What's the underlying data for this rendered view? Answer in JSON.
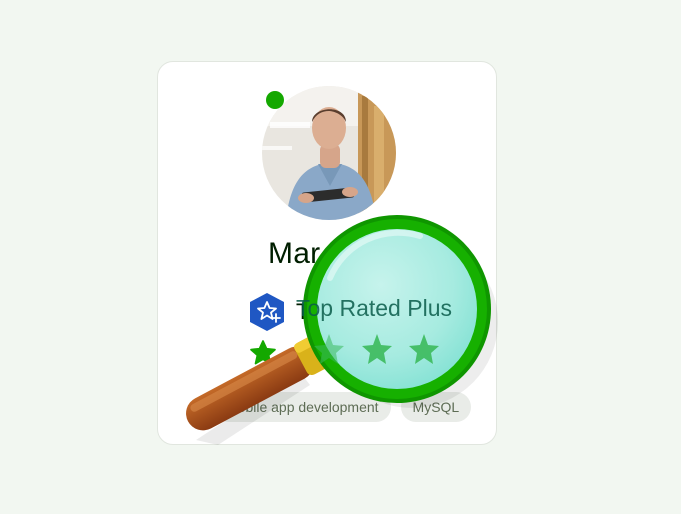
{
  "profile": {
    "name": "Mar",
    "badge_label": "Top Rated Plus",
    "rating": 5,
    "skills": [
      "Mobile app development",
      "MySQL"
    ]
  },
  "colors": {
    "accent": "#14a800",
    "badge_blue": "#1f57c3",
    "text": "#001e00"
  },
  "icons": {
    "badge": "star-plus-hexagon-icon",
    "magnifier": "magnifying-glass-icon"
  }
}
